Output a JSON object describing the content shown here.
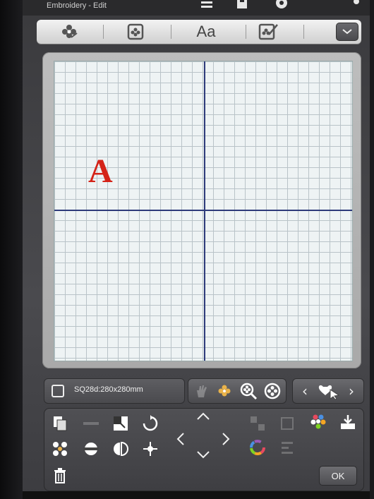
{
  "window": {
    "title": "Embroidery - Edit"
  },
  "toolbar": {
    "tabs": [
      {
        "icon": "embroidery-design-icon"
      },
      {
        "icon": "design-frame-icon"
      },
      {
        "label": "Aa",
        "icon": "text-letters-icon"
      },
      {
        "icon": "edit-design-icon"
      }
    ],
    "dropdown_icon": "chevron-down-icon"
  },
  "canvas": {
    "design_text": "A",
    "design_color": "#d42318",
    "axis_color": "#2d3a7a"
  },
  "hoop": {
    "label": "SQ28d:280x280mm"
  },
  "zoom_group": {
    "buttons": [
      "pan-hand-icon",
      "design-select-icon",
      "zoom-in-icon",
      "zoom-out-icon"
    ]
  },
  "nav_group": {
    "prev": "‹",
    "next": "›",
    "icon": "select-design-icon"
  },
  "edit_tools": {
    "ok_label": "OK"
  }
}
